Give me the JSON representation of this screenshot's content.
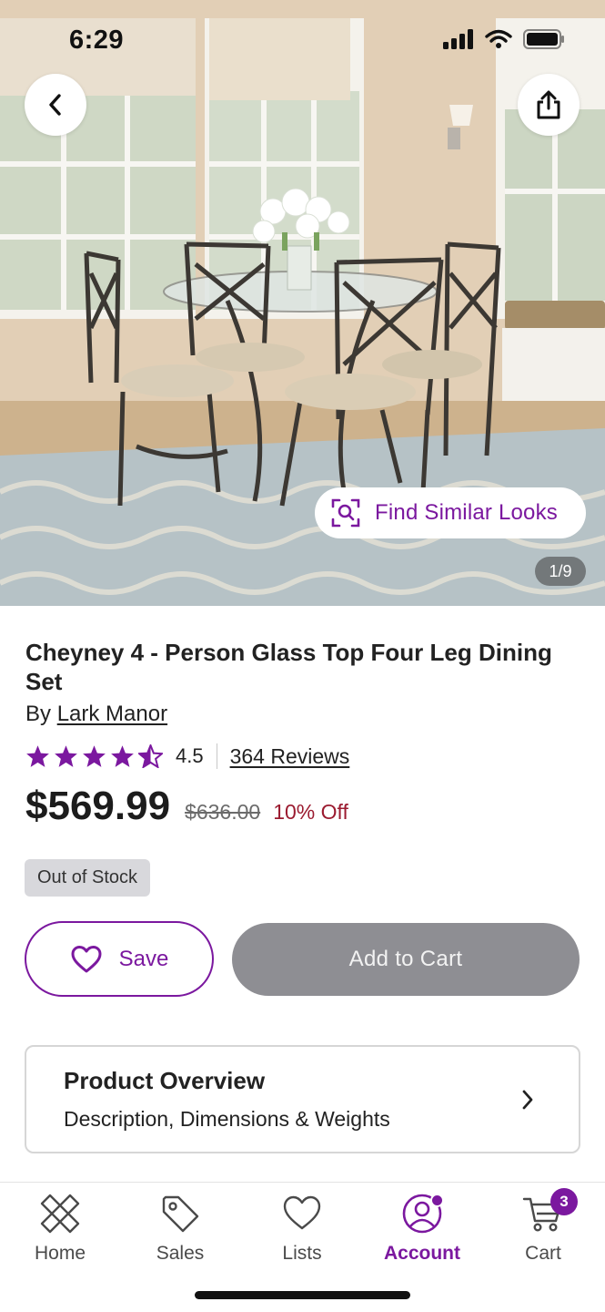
{
  "status_bar": {
    "time": "6:29"
  },
  "hero": {
    "find_similar_label": "Find Similar Looks",
    "image_counter": "1/9"
  },
  "product": {
    "title": "Cheyney 4 - Person Glass Top Four Leg Dining Set",
    "by_prefix": "By",
    "brand": "Lark Manor",
    "rating": "4.5",
    "rating_value": 4.5,
    "reviews": "364 Reviews",
    "price": "$569.99",
    "old_price": "$636.00",
    "discount": "10% Off",
    "stock_status": "Out of Stock"
  },
  "actions": {
    "save_label": "Save",
    "add_to_cart_label": "Add to Cart"
  },
  "overview": {
    "title": "Product Overview",
    "subtitle": "Description, Dimensions & Weights"
  },
  "nav": {
    "items": [
      {
        "label": "Home",
        "icon": "home-icon"
      },
      {
        "label": "Sales",
        "icon": "tag-icon"
      },
      {
        "label": "Lists",
        "icon": "heart-icon"
      },
      {
        "label": "Account",
        "icon": "account-icon",
        "active": true
      },
      {
        "label": "Cart",
        "icon": "cart-icon"
      }
    ],
    "cart_count": "3"
  },
  "colors": {
    "accent": "#7b189f",
    "discount": "#9b1b30",
    "disabled_button": "#8e8e93",
    "badge_bg": "#d8d8dc"
  }
}
